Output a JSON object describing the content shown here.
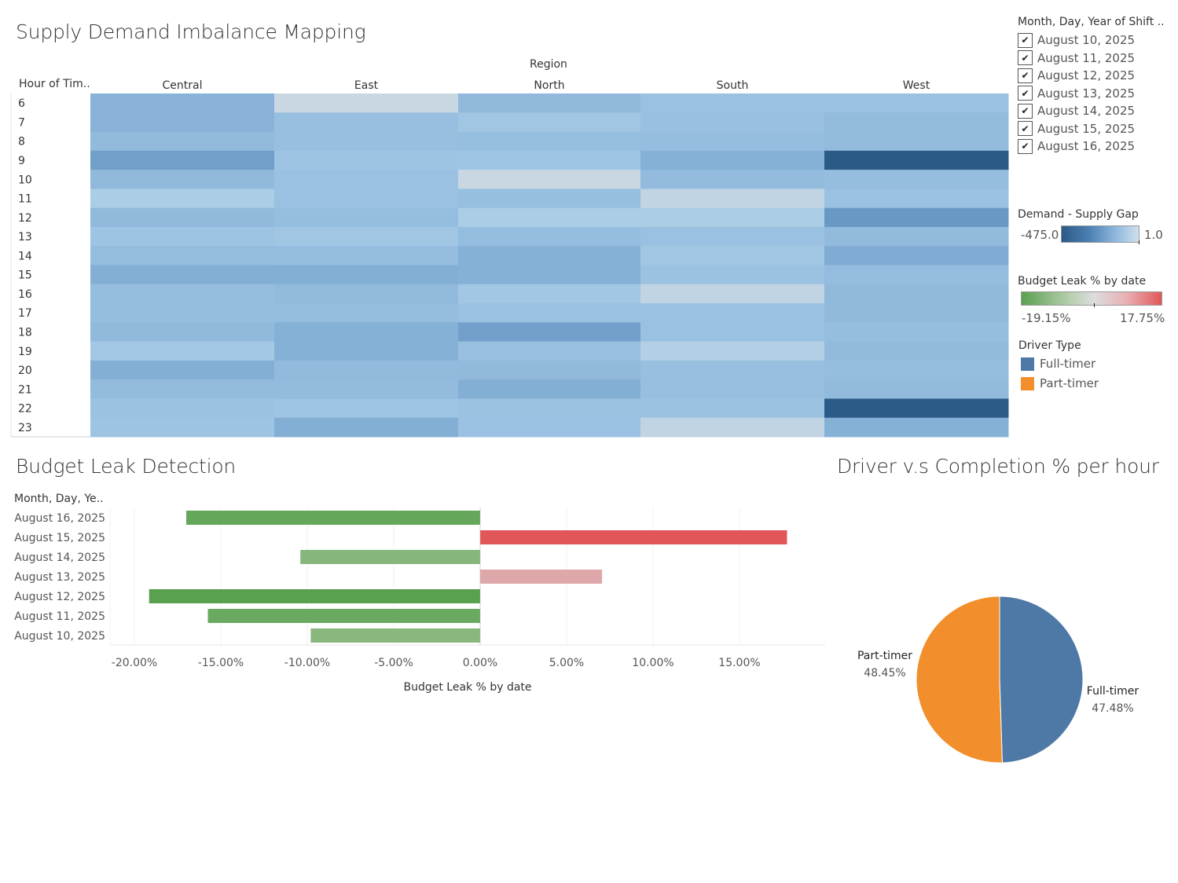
{
  "dashboard": {
    "heatmap_title": "Supply Demand Imbalance Mapping",
    "budget_title": "Budget Leak Detection",
    "pie_title": "Driver v.s Completion % per hour"
  },
  "filter": {
    "title": "Month, Day, Year of Shift ..",
    "items": [
      {
        "label": "August 10, 2025",
        "checked": true
      },
      {
        "label": "August 11, 2025",
        "checked": true
      },
      {
        "label": "August 12, 2025",
        "checked": true
      },
      {
        "label": "August 13, 2025",
        "checked": true
      },
      {
        "label": "August 14, 2025",
        "checked": true
      },
      {
        "label": "August 15, 2025",
        "checked": true
      },
      {
        "label": "August 16, 2025",
        "checked": true
      }
    ],
    "check_glyph": "✔"
  },
  "legends": {
    "demand": {
      "title": "Demand - Supply Gap",
      "min": "-475.0",
      "max": "1.0"
    },
    "budget": {
      "title": "Budget Leak % by date",
      "min": "-19.15%",
      "max": "17.75%"
    },
    "driver": {
      "title": "Driver Type",
      "items": [
        {
          "label": "Full-timer",
          "color": "#4e79a7"
        },
        {
          "label": "Part-timer",
          "color": "#f28e2b"
        }
      ]
    }
  },
  "chart_data": [
    {
      "type": "heatmap",
      "title": "Supply Demand Imbalance Mapping",
      "column_header": "Region",
      "row_header": "Hour of Tim..",
      "columns": [
        "Central",
        "East",
        "North",
        "South",
        "West"
      ],
      "rows": [
        "6",
        "7",
        "8",
        "9",
        "10",
        "11",
        "12",
        "13",
        "14",
        "15",
        "16",
        "17",
        "18",
        "19",
        "20",
        "21",
        "22",
        "23"
      ],
      "color_measure": "Demand - Supply Gap",
      "color_range": [
        -475.0,
        1.0
      ],
      "values": [
        [
          -150,
          10,
          -130,
          -90,
          -90
        ],
        [
          -150,
          -100,
          -70,
          -95,
          -120
        ],
        [
          -125,
          -100,
          -105,
          -110,
          -120
        ],
        [
          -210,
          -80,
          -75,
          -155,
          -475
        ],
        [
          -130,
          -90,
          1,
          -120,
          -110
        ],
        [
          -40,
          -90,
          -105,
          -10,
          -90
        ],
        [
          -130,
          -110,
          -40,
          -40,
          -230
        ],
        [
          -80,
          -70,
          -110,
          -90,
          -125
        ],
        [
          -115,
          -110,
          -155,
          -65,
          -170
        ],
        [
          -160,
          -160,
          -155,
          -85,
          -115
        ],
        [
          -110,
          -125,
          -65,
          -10,
          -130
        ],
        [
          -110,
          -110,
          -90,
          -90,
          -130
        ],
        [
          -130,
          -155,
          -205,
          -90,
          -110
        ],
        [
          -60,
          -155,
          -95,
          -30,
          -125
        ],
        [
          -160,
          -125,
          -130,
          -100,
          -110
        ],
        [
          -120,
          -120,
          -160,
          -100,
          -125
        ],
        [
          -85,
          -75,
          -85,
          -85,
          -470
        ],
        [
          -80,
          -160,
          -90,
          -10,
          -155
        ]
      ]
    },
    {
      "type": "bar",
      "title": "Budget Leak Detection",
      "row_header": "Month, Day, Ye..",
      "categories": [
        "August 16, 2025",
        "August 15, 2025",
        "August 14, 2025",
        "August 13, 2025",
        "August 12, 2025",
        "August 11, 2025",
        "August 10, 2025"
      ],
      "values": [
        -17.0,
        17.75,
        -10.4,
        7.05,
        -19.15,
        -15.75,
        -9.8
      ],
      "xlabel": "Budget Leak % by date",
      "xlim": [
        -21.0,
        19.5
      ],
      "xticks": [
        -20,
        -15,
        -10,
        -5,
        0,
        5,
        10,
        15
      ],
      "xtick_labels": [
        "-20.00%",
        "-15.00%",
        "-10.00%",
        "-5.00%",
        "0.00%",
        "5.00%",
        "10.00%",
        "15.00%"
      ],
      "color_range": [
        -19.15,
        17.75
      ],
      "grid": true
    },
    {
      "type": "pie",
      "title": "Driver v.s Completion % per hour",
      "slices": [
        {
          "label": "Full-timer",
          "value": 47.48,
          "value_label": "47.48%",
          "color": "#4e79a7"
        },
        {
          "label": "Part-timer",
          "value": 48.45,
          "value_label": "48.45%",
          "color": "#f28e2b"
        }
      ]
    }
  ]
}
